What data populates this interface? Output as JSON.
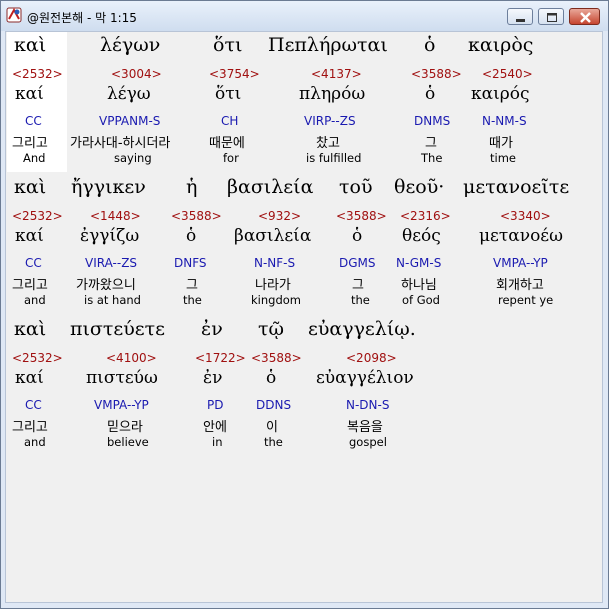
{
  "window": {
    "title": "@원전본해 - 막 1:15"
  },
  "icons": {
    "app": "dictionary-app-icon",
    "minimize": "minimize-icon",
    "maximize": "maximize-icon",
    "close": "close-icon"
  },
  "lines": [
    {
      "words": [
        {
          "greek": "καὶ",
          "strong": "<2532>",
          "lemma": "καί",
          "parsing": "CC",
          "korean": "그리고",
          "english": "And"
        },
        {
          "greek": "λέγων",
          "strong": "<3004>",
          "lemma": "λέγω",
          "parsing": "VPPANM-S",
          "korean": "가라사대-하시더라",
          "english": "saying"
        },
        {
          "greek": "ὅτι",
          "strong": "<3754>",
          "lemma": "ὅτι",
          "parsing": "CH",
          "korean": "때문에",
          "english": "for"
        },
        {
          "greek": "Πεπλήρωται",
          "strong": "<4137>",
          "lemma": "πληρόω",
          "parsing": "VIRP--ZS",
          "korean": "찼고",
          "english": "is fulfilled"
        },
        {
          "greek": "ὁ",
          "strong": "<3588>",
          "lemma": "ὁ",
          "parsing": "DNMS",
          "korean": "그",
          "english": "The"
        },
        {
          "greek": "καιρὸς",
          "strong": "<2540>",
          "lemma": "καιρός",
          "parsing": "N-NM-S",
          "korean": "때가",
          "english": "time"
        }
      ]
    },
    {
      "words": [
        {
          "greek": "καὶ",
          "strong": "<2532>",
          "lemma": "καί",
          "parsing": "CC",
          "korean": "그리고",
          "english": "and"
        },
        {
          "greek": "ἤγγικεν",
          "strong": "<1448>",
          "lemma": "ἐγγίζω",
          "parsing": "VIRA--ZS",
          "korean": "가까왔으니",
          "english": "is at hand"
        },
        {
          "greek": "ἡ",
          "strong": "<3588>",
          "lemma": "ὁ",
          "parsing": "DNFS",
          "korean": "그",
          "english": "the"
        },
        {
          "greek": "βασιλεία",
          "strong": "<932>",
          "lemma": "βασιλεία",
          "parsing": "N-NF-S",
          "korean": "나라가",
          "english": "kingdom"
        },
        {
          "greek": "τοῦ",
          "strong": "<3588>",
          "lemma": "ὁ",
          "parsing": "DGMS",
          "korean": "그",
          "english": "the"
        },
        {
          "greek": "θεοῦ·",
          "strong": "<2316>",
          "lemma": "θεός",
          "parsing": "N-GM-S",
          "korean": "하나님",
          "english": "of God"
        },
        {
          "greek": "μετανοεῖτε",
          "strong": "<3340>",
          "lemma": "μετανοέω",
          "parsing": "VMPA--YP",
          "korean": "회개하고",
          "english": "repent ye"
        }
      ]
    },
    {
      "words": [
        {
          "greek": "καὶ",
          "strong": "<2532>",
          "lemma": "καί",
          "parsing": "CC",
          "korean": "그리고",
          "english": "and"
        },
        {
          "greek": "πιστεύετε",
          "strong": "<4100>",
          "lemma": "πιστεύω",
          "parsing": "VMPA--YP",
          "korean": "믿으라",
          "english": "believe"
        },
        {
          "greek": "ἐν",
          "strong": "<1722>",
          "lemma": "ἐν",
          "parsing": "PD",
          "korean": "안에",
          "english": "in"
        },
        {
          "greek": "τῷ",
          "strong": "<3588>",
          "lemma": "ὁ",
          "parsing": "DDNS",
          "korean": "이",
          "english": "the"
        },
        {
          "greek": "εὐαγγελίῳ.",
          "strong": "<2098>",
          "lemma": "εὐαγγέλιον",
          "parsing": "N-DN-S",
          "korean": "복음을",
          "english": "gospel"
        }
      ]
    }
  ]
}
